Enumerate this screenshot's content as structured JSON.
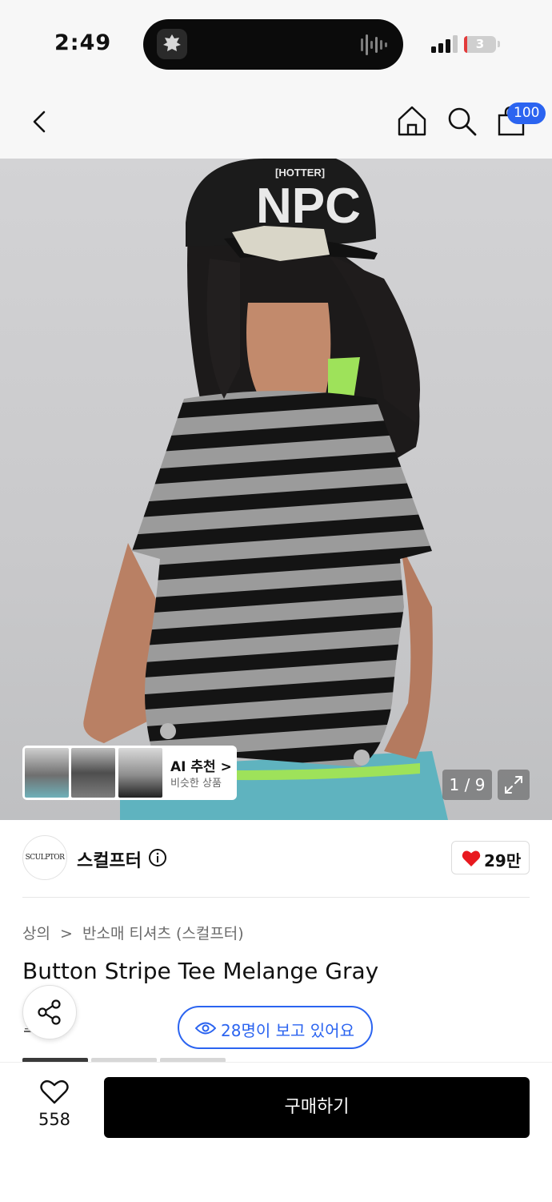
{
  "status_bar": {
    "time": "2:49",
    "battery_level": "3"
  },
  "nav": {
    "cart_count": "100"
  },
  "hero": {
    "ai_title": "AI 추천 >",
    "ai_subtitle": "비슷한 상품",
    "counter": "1 / 9"
  },
  "brand": {
    "logo_text": "SCULPTOR",
    "name": "스컬프터",
    "likes": "29만"
  },
  "breadcrumb": [
    "상의",
    ">",
    "반소매 티셔츠 (스컬프터)"
  ],
  "product": {
    "title": "Button Stripe Tee Melange Gray",
    "viewers": "28명이 보고 있어요",
    "underlined_partial": "스 매"
  },
  "bottom_bar": {
    "fav_count": "558",
    "buy_label": "구매하기"
  },
  "colors": {
    "accent": "#2b64f0",
    "heart": "#e8191f",
    "buy_button": "#000000"
  }
}
